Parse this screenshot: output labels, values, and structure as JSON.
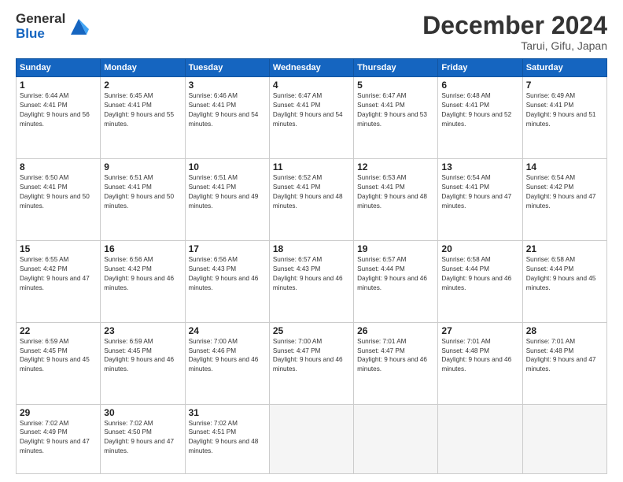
{
  "header": {
    "logo_line1": "General",
    "logo_line2": "Blue",
    "month": "December 2024",
    "location": "Tarui, Gifu, Japan"
  },
  "weekdays": [
    "Sunday",
    "Monday",
    "Tuesday",
    "Wednesday",
    "Thursday",
    "Friday",
    "Saturday"
  ],
  "weeks": [
    [
      {
        "day": "1",
        "sunrise": "6:44 AM",
        "sunset": "4:41 PM",
        "daylight": "9 hours and 56 minutes."
      },
      {
        "day": "2",
        "sunrise": "6:45 AM",
        "sunset": "4:41 PM",
        "daylight": "9 hours and 55 minutes."
      },
      {
        "day": "3",
        "sunrise": "6:46 AM",
        "sunset": "4:41 PM",
        "daylight": "9 hours and 54 minutes."
      },
      {
        "day": "4",
        "sunrise": "6:47 AM",
        "sunset": "4:41 PM",
        "daylight": "9 hours and 54 minutes."
      },
      {
        "day": "5",
        "sunrise": "6:47 AM",
        "sunset": "4:41 PM",
        "daylight": "9 hours and 53 minutes."
      },
      {
        "day": "6",
        "sunrise": "6:48 AM",
        "sunset": "4:41 PM",
        "daylight": "9 hours and 52 minutes."
      },
      {
        "day": "7",
        "sunrise": "6:49 AM",
        "sunset": "4:41 PM",
        "daylight": "9 hours and 51 minutes."
      }
    ],
    [
      {
        "day": "8",
        "sunrise": "6:50 AM",
        "sunset": "4:41 PM",
        "daylight": "9 hours and 50 minutes."
      },
      {
        "day": "9",
        "sunrise": "6:51 AM",
        "sunset": "4:41 PM",
        "daylight": "9 hours and 50 minutes."
      },
      {
        "day": "10",
        "sunrise": "6:51 AM",
        "sunset": "4:41 PM",
        "daylight": "9 hours and 49 minutes."
      },
      {
        "day": "11",
        "sunrise": "6:52 AM",
        "sunset": "4:41 PM",
        "daylight": "9 hours and 48 minutes."
      },
      {
        "day": "12",
        "sunrise": "6:53 AM",
        "sunset": "4:41 PM",
        "daylight": "9 hours and 48 minutes."
      },
      {
        "day": "13",
        "sunrise": "6:54 AM",
        "sunset": "4:41 PM",
        "daylight": "9 hours and 47 minutes."
      },
      {
        "day": "14",
        "sunrise": "6:54 AM",
        "sunset": "4:42 PM",
        "daylight": "9 hours and 47 minutes."
      }
    ],
    [
      {
        "day": "15",
        "sunrise": "6:55 AM",
        "sunset": "4:42 PM",
        "daylight": "9 hours and 47 minutes."
      },
      {
        "day": "16",
        "sunrise": "6:56 AM",
        "sunset": "4:42 PM",
        "daylight": "9 hours and 46 minutes."
      },
      {
        "day": "17",
        "sunrise": "6:56 AM",
        "sunset": "4:43 PM",
        "daylight": "9 hours and 46 minutes."
      },
      {
        "day": "18",
        "sunrise": "6:57 AM",
        "sunset": "4:43 PM",
        "daylight": "9 hours and 46 minutes."
      },
      {
        "day": "19",
        "sunrise": "6:57 AM",
        "sunset": "4:44 PM",
        "daylight": "9 hours and 46 minutes."
      },
      {
        "day": "20",
        "sunrise": "6:58 AM",
        "sunset": "4:44 PM",
        "daylight": "9 hours and 46 minutes."
      },
      {
        "day": "21",
        "sunrise": "6:58 AM",
        "sunset": "4:44 PM",
        "daylight": "9 hours and 45 minutes."
      }
    ],
    [
      {
        "day": "22",
        "sunrise": "6:59 AM",
        "sunset": "4:45 PM",
        "daylight": "9 hours and 45 minutes."
      },
      {
        "day": "23",
        "sunrise": "6:59 AM",
        "sunset": "4:45 PM",
        "daylight": "9 hours and 46 minutes."
      },
      {
        "day": "24",
        "sunrise": "7:00 AM",
        "sunset": "4:46 PM",
        "daylight": "9 hours and 46 minutes."
      },
      {
        "day": "25",
        "sunrise": "7:00 AM",
        "sunset": "4:47 PM",
        "daylight": "9 hours and 46 minutes."
      },
      {
        "day": "26",
        "sunrise": "7:01 AM",
        "sunset": "4:47 PM",
        "daylight": "9 hours and 46 minutes."
      },
      {
        "day": "27",
        "sunrise": "7:01 AM",
        "sunset": "4:48 PM",
        "daylight": "9 hours and 46 minutes."
      },
      {
        "day": "28",
        "sunrise": "7:01 AM",
        "sunset": "4:48 PM",
        "daylight": "9 hours and 47 minutes."
      }
    ],
    [
      {
        "day": "29",
        "sunrise": "7:02 AM",
        "sunset": "4:49 PM",
        "daylight": "9 hours and 47 minutes."
      },
      {
        "day": "30",
        "sunrise": "7:02 AM",
        "sunset": "4:50 PM",
        "daylight": "9 hours and 47 minutes."
      },
      {
        "day": "31",
        "sunrise": "7:02 AM",
        "sunset": "4:51 PM",
        "daylight": "9 hours and 48 minutes."
      },
      null,
      null,
      null,
      null
    ]
  ]
}
